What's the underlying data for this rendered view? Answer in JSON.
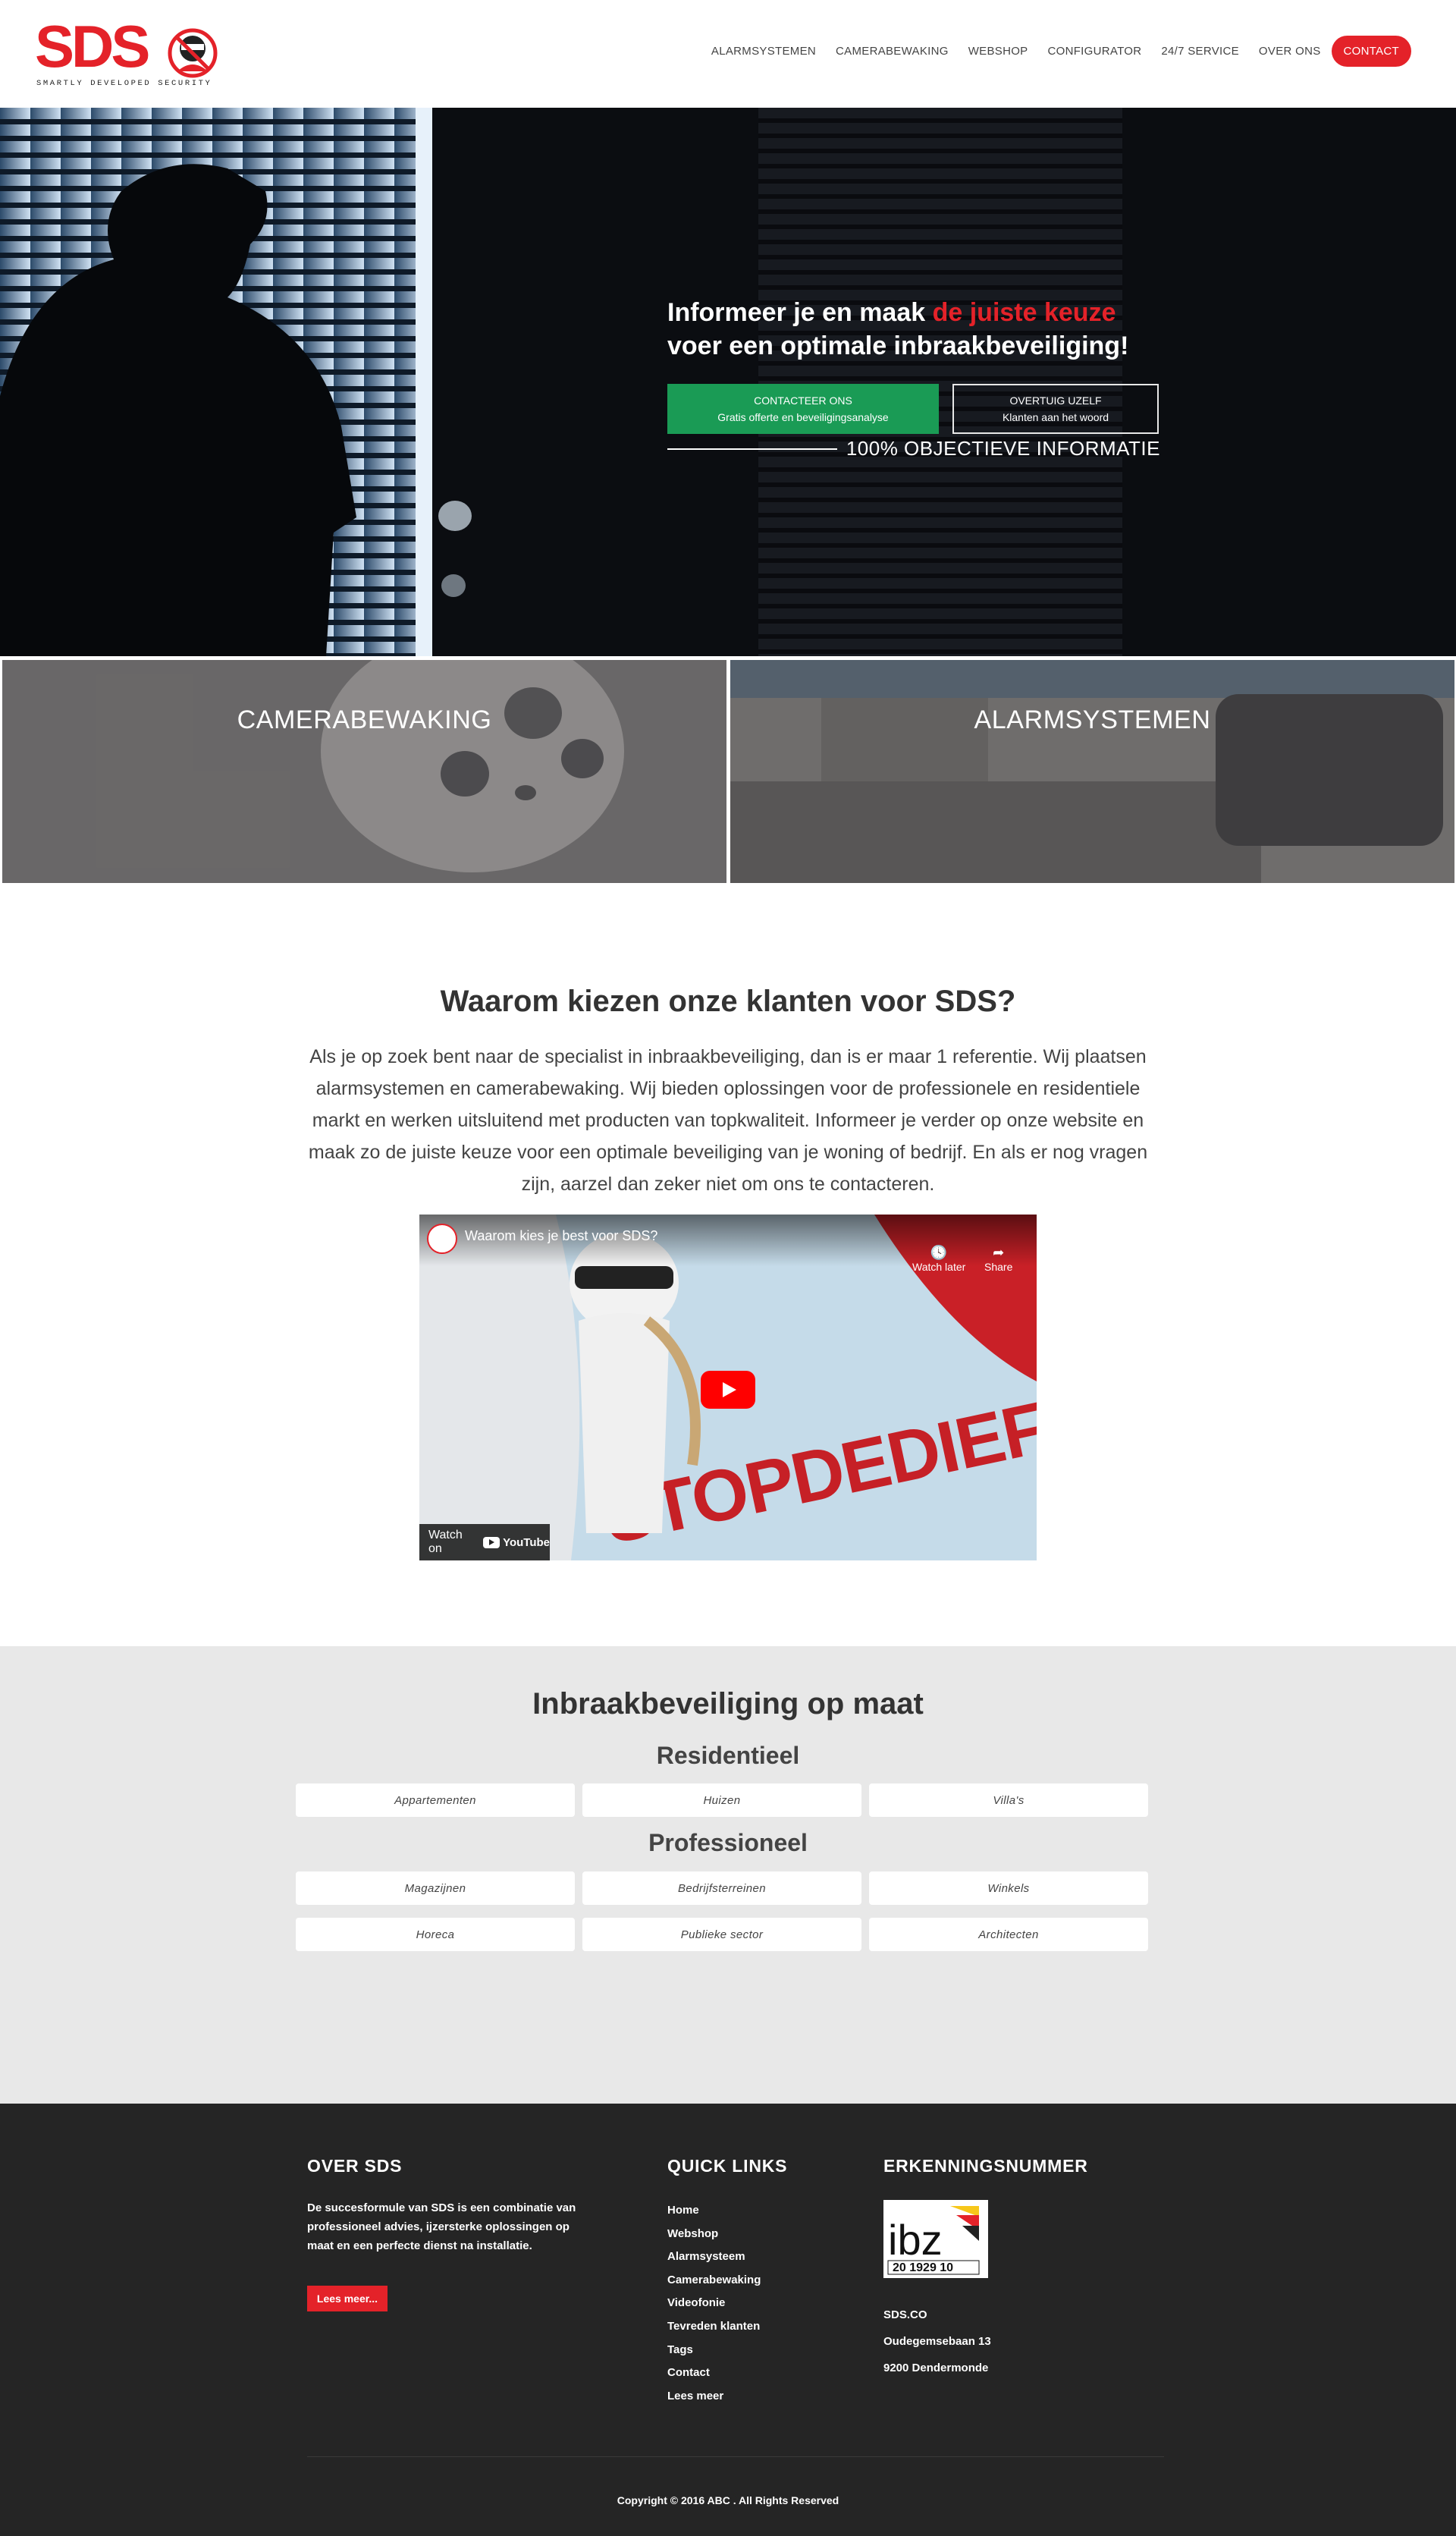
{
  "logo": {
    "text": "SDS",
    "tagline": "SMARTLY DEVELOPED SECURITY"
  },
  "nav": {
    "items": [
      "ALARMSYSTEMEN",
      "CAMERABEWAKING",
      "WEBSHOP",
      "CONFIGURATOR",
      "24/7 SERVICE",
      "OVER ONS"
    ],
    "contact": "CONTACT"
  },
  "hero": {
    "title_part1": "Informeer je en maak ",
    "title_highlight": "de juiste keuze",
    "title_line2": "voer een optimale inbraakbeveiliging!",
    "btn_contact_line1": "CONTACTEER ONS",
    "btn_contact_line2": "Gratis offerte en beveiligingsanalyse",
    "btn_reviews_line1": "OVERTUIG UZELF",
    "btn_reviews_line2": "Klanten aan het woord",
    "objective": "100% OBJECTIEVE INFORMATIE"
  },
  "tiles": {
    "camera": "CAMERABEWAKING",
    "alarm": "ALARMSYSTEMEN"
  },
  "why": {
    "title": "Waarom kiezen onze klanten voor SDS?",
    "text": "Als je op zoek bent naar de specialist in inbraakbeveiliging, dan is er maar 1 referentie. Wij plaatsen alarmsystemen en camerabewaking. Wij bieden oplossingen voor de professionele en residentiele markt en werken uitsluitend met producten van topkwaliteit. Informeer je verder op onze website en maak zo de juiste keuze voor een optimale beveiliging van je woning of bedrijf. En als er nog vragen zijn, aarzel dan zeker niet om ons te contacteren."
  },
  "video": {
    "title": "Waarom kies je best voor SDS?",
    "watch_later": "Watch later",
    "share": "Share",
    "watch_on": "Watch on",
    "youtube": "YouTube",
    "van_text": "STOPDEDIEF.BE"
  },
  "custom": {
    "title": "Inbraakbeveiliging op maat",
    "residential_title": "Residentieel",
    "residential": [
      "Appartementen",
      "Huizen",
      "Villa's"
    ],
    "professional_title": "Professioneel",
    "professional": [
      "Magazijnen",
      "Bedrijfsterreinen",
      "Winkels",
      "Horeca",
      "Publieke sector",
      "Architecten"
    ]
  },
  "footer": {
    "about_title": "OVER SDS",
    "about_text": "De succesformule van SDS is een combinatie van professioneel advies, ijzersterke oplossingen op maat en een perfecte dienst na installatie.",
    "read_more": "Lees meer...",
    "links_title": "QUICK LINKS",
    "links": [
      "Home",
      "Webshop",
      "Alarmsysteem",
      "Camerabewaking",
      "Videofonie",
      "Tevreden klanten",
      "Tags",
      "Contact",
      "Lees meer"
    ],
    "erk_title": "ERKENNINGSNUMMER",
    "ibz_text": "ibz",
    "ibz_number": "20 1929 10",
    "company": "SDS.CO",
    "street": "Oudegemsebaan 13",
    "city": "9200 Dendermonde",
    "copyright": "Copyright © 2016 ABC . All Rights Reserved"
  },
  "colors": {
    "brand_red": "#e42229",
    "cta_green": "#1a9b55",
    "footer_bg": "#252525",
    "section_grey": "#e8e8e8"
  }
}
